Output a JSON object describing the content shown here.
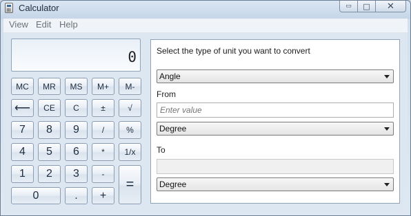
{
  "window": {
    "title": "Calculator",
    "controls": {
      "minimize": "▭",
      "maximize": "□",
      "close": "✕"
    }
  },
  "menu": [
    "View",
    "Edit",
    "Help"
  ],
  "display": {
    "value": "0"
  },
  "keypad": {
    "memory": [
      "MC",
      "MR",
      "MS",
      "M+",
      "M-"
    ],
    "row2": [
      "⟵",
      "CE",
      "C",
      "±",
      "√"
    ],
    "row3": [
      "7",
      "8",
      "9",
      "/",
      "%"
    ],
    "row4": [
      "4",
      "5",
      "6",
      "*",
      "1/x"
    ],
    "row5": [
      "1",
      "2",
      "3",
      "-"
    ],
    "row6": [
      "0",
      ".",
      "+"
    ],
    "equals": "="
  },
  "converter": {
    "prompt": "Select the type of unit you want to convert",
    "type_value": "Angle",
    "from_label": "From",
    "from_placeholder": "Enter value",
    "from_unit": "Degree",
    "to_label": "To",
    "to_value": "",
    "to_unit": "Degree"
  }
}
